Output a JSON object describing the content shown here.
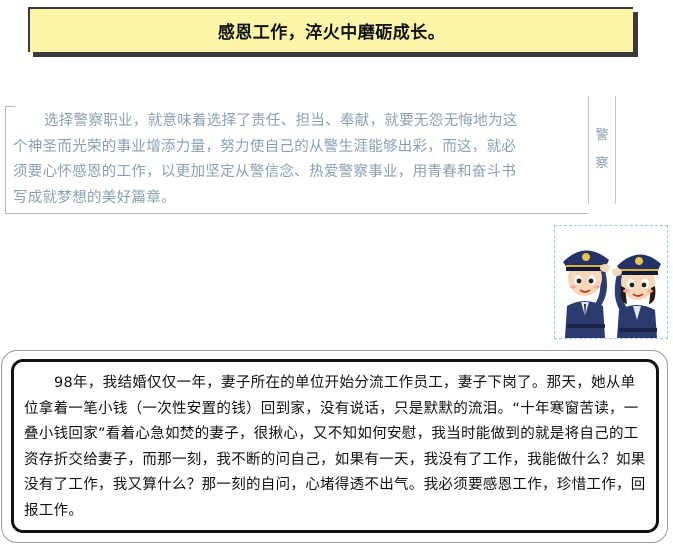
{
  "header": {
    "title": "感恩工作，淬火中磨砺成长。"
  },
  "intro": {
    "paragraph": "选择警察职业，就意味着选择了责任、担当、奉献，就要无怨无悔地为这个神圣而光荣的事业增添力量，努力使自己的从警生涯能够出彩，而这，就必须要心怀感恩的工作，以更加坚定从警信念、热爱警察事业，用青春和奋斗书写成就梦想的美好篇章。",
    "side_tab": [
      "警",
      "察"
    ]
  },
  "illustration": {
    "subject": "two cartoon police officers saluting"
  },
  "story": {
    "paragraph": "98年，我结婚仅仅一年，妻子所在的单位开始分流工作员工，妻子下岗了。那天，她从单位拿着一笔小钱（一次性安置的钱）回到家，没有说话，只是默默的流泪。“十年寒窗苦读，一叠小钱回家”看着心急如焚的妻子，很揪心，又不知如何安慰，我当时能做到的就是将自己的工资存折交给妻子，而那一刻，我不断的问自己，如果有一天，我没有了工作，我能做什么？如果没有了工作，我又算什么？那一刻的自问，心堵得透不出气。我必须要感恩工作，珍惜工作，回报工作。"
  },
  "colors": {
    "title_bg": "#fdf5a8",
    "intro_text": "#8aa0b2",
    "story_text": "#111111"
  }
}
